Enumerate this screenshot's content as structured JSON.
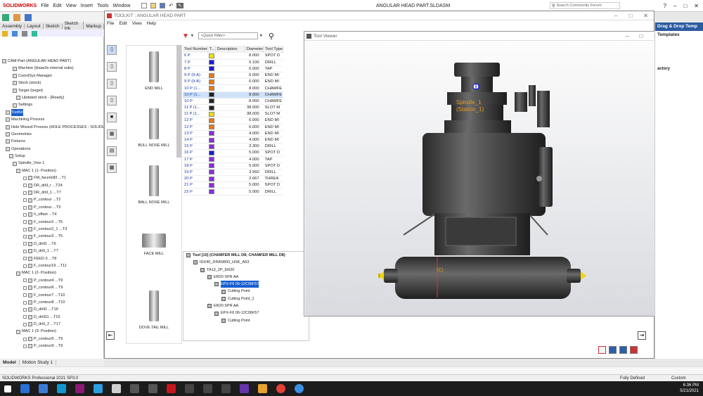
{
  "app": {
    "brand": "SOLIDWORKS",
    "menu": [
      "File",
      "Edit",
      "View",
      "Insert",
      "Tools",
      "Window"
    ],
    "doc_title": "ANGULAR HEAD PART.SLDASM",
    "search_placeholder": "Search Community Forum"
  },
  "cmd_tabs": [
    "Assembly",
    "Layout",
    "Sketch",
    "Sketch Ink",
    "Markup"
  ],
  "tree": [
    {
      "label": "CAM-Part (ANGULAR HEAD PART)",
      "indent": 0
    },
    {
      "label": "Machine (Haas3x internal subs)",
      "indent": 3
    },
    {
      "label": "CoordSys Manager",
      "indent": 3
    },
    {
      "label": "Stock (stock)",
      "indent": 3
    },
    {
      "label": "Target (target)",
      "indent": 3
    },
    {
      "label": "Updated stock - [Ready]",
      "indent": 4
    },
    {
      "label": "Settings",
      "indent": 3
    },
    {
      "label": "ToolKit",
      "indent": 1,
      "selected": true
    },
    {
      "label": "Machining Process",
      "indent": 1
    },
    {
      "label": "Hole Wizard Process (HOLE PROCESSES - SOLIDWO",
      "indent": 1
    },
    {
      "label": "Geometries",
      "indent": 1
    },
    {
      "label": "Fixtures",
      "indent": 1
    },
    {
      "label": "Operations",
      "indent": 1
    },
    {
      "label": "Setup",
      "indent": 2
    },
    {
      "label": "Spindle_Vise 1",
      "indent": 3
    },
    {
      "label": "MAC 1 (1- Position)",
      "indent": 4
    },
    {
      "label": "FM_facemill3 ...T1",
      "indent": 6
    },
    {
      "label": "DR_drill_r ...T24",
      "indent": 6
    },
    {
      "label": "DR_drill_1 ...T7",
      "indent": 6
    },
    {
      "label": "P_contour ...T2",
      "indent": 6
    },
    {
      "label": "P_contour ...T3",
      "indent": 6
    },
    {
      "label": "h_offset ...T4",
      "indent": 6
    },
    {
      "label": "F_contour2 ...T5",
      "indent": 6
    },
    {
      "label": "F_contour2_1 ...T3",
      "indent": 6
    },
    {
      "label": "F_contour3 ...T5",
      "indent": 6
    },
    {
      "label": "D_drill1 ...T6",
      "indent": 6
    },
    {
      "label": "D_drill_1 ...T7",
      "indent": 6
    },
    {
      "label": "FEED 0 ...T8",
      "indent": 6
    },
    {
      "label": "F_contour19 ...T11",
      "indent": 6
    },
    {
      "label": "MAC 1 (2- Position)",
      "indent": 4
    },
    {
      "label": "P_contour4 ...T9",
      "indent": 6
    },
    {
      "label": "P_contour6 ...T9",
      "indent": 6
    },
    {
      "label": "F_contour7 ...T10",
      "indent": 6
    },
    {
      "label": "P_contour8 ...T10",
      "indent": 6
    },
    {
      "label": "D_drill1 ...T16",
      "indent": 6
    },
    {
      "label": "D_drill11 ...T15",
      "indent": 6
    },
    {
      "label": "D_drill_2 ...T17",
      "indent": 6
    },
    {
      "label": "MAC 1 (3- Position)",
      "indent": 4
    },
    {
      "label": "P_contour5 ...T9",
      "indent": 6
    },
    {
      "label": "P_contour9 ...T9",
      "indent": 6
    }
  ],
  "toolkit": {
    "title": "TOOLKIT : ANGULAR HEAD PART",
    "menu": [
      "File",
      "Edit",
      "View",
      "Help"
    ],
    "filter_placeholder": "<Quick Filter>",
    "cards": [
      "END MILL",
      "BULL NOSE MILL",
      "BALL NOSE MILL",
      "FACE MILL",
      "DOVE TAIL MILL"
    ],
    "columns": [
      "Tool Number",
      "T...",
      "Description",
      "Diameter",
      "Tool Type"
    ],
    "rows": [
      {
        "num": "6 P",
        "color": "#f0e000",
        "dia": "8.000",
        "type": "SPOT D"
      },
      {
        "num": "7 P",
        "color": "#1a1ad8",
        "dia": "5.100",
        "type": "DRILL"
      },
      {
        "num": "8 P",
        "color": "#1a1ad8",
        "dia": "6.000",
        "type": "TAP"
      },
      {
        "num": "9 P (9-A)",
        "color": "#e87a10",
        "dia": "6.000",
        "type": "END MI"
      },
      {
        "num": "9 P (9-B)",
        "color": "#e87a10",
        "dia": "6.000",
        "type": "END MI"
      },
      {
        "num": "10 P (1...",
        "color": "#e87a10",
        "dia": "8.000",
        "type": "CHAMFE"
      },
      {
        "num": "10 P (1...",
        "color": "#222222",
        "dia": "8.000",
        "type": "CHAMFE",
        "selected": true
      },
      {
        "num": "10 P",
        "color": "#222222",
        "dia": "8.000",
        "type": "CHAMFE"
      },
      {
        "num": "11 P (1...",
        "color": "#222222",
        "dia": "38.000",
        "type": "SLOT M"
      },
      {
        "num": "11 P (1...",
        "color": "#f0e000",
        "dia": "38.000",
        "type": "SLOT M"
      },
      {
        "num": "12 P",
        "color": "#e87a10",
        "dia": "6.000",
        "type": "END MI"
      },
      {
        "num": "12 P",
        "color": "#e87a10",
        "dia": "6.000",
        "type": "END MI"
      },
      {
        "num": "13 P",
        "color": "#8a2be2",
        "dia": "4.000",
        "type": "END MI"
      },
      {
        "num": "14 P",
        "color": "#8a2be2",
        "dia": "4.000",
        "type": "END MI"
      },
      {
        "num": "15 P",
        "color": "#8a2be2",
        "dia": "3.300",
        "type": "DRILL"
      },
      {
        "num": "16 P",
        "color": "#1a1ad8",
        "dia": "5.000",
        "type": "SPOT D"
      },
      {
        "num": "17 P",
        "color": "#8a2be2",
        "dia": "4.000",
        "type": "TAP"
      },
      {
        "num": "18 P",
        "color": "#8a2be2",
        "dia": "5.000",
        "type": "SPOT D"
      },
      {
        "num": "19 P",
        "color": "#8a2be2",
        "dia": "3.560",
        "type": "DRILL"
      },
      {
        "num": "20 P",
        "color": "#8a2be2",
        "dia": "2.667",
        "type": "THREA"
      },
      {
        "num": "21 P",
        "color": "#8a2be2",
        "dia": "5.000",
        "type": "SPOT D"
      },
      {
        "num": "22 P",
        "color": "#8a2be2",
        "dia": "5.000",
        "type": "DRILL"
      }
    ],
    "assembly": [
      {
        "label": "Tool [10] (CHAMFER MILL D8; CHAMFER MILL D8)",
        "indent": 0,
        "bold": true
      },
      {
        "label": "IDX40_DIN69893_HSK_A63",
        "indent": 1
      },
      {
        "label": "TA13_2P_ER20",
        "indent": 2
      },
      {
        "label": "ER20 SPR AA",
        "indent": 3
      },
      {
        "label": "EPX-F6 06-12C06F57",
        "indent": 4,
        "selected": true
      },
      {
        "label": "Cutting Point",
        "indent": 5
      },
      {
        "label": "Cutting Point_1",
        "indent": 5
      },
      {
        "label": "ER20 SPR AA",
        "indent": 3
      },
      {
        "label": "EPX-F6 06-12C06F57",
        "indent": 4
      },
      {
        "label": "Cutting Point",
        "indent": 5
      }
    ]
  },
  "viewer": {
    "title": "Tool Viewer",
    "spindle_label": "Spindle_1 (Station_1)",
    "c_label": "(C)"
  },
  "right_panel": {
    "header": "Drag & Drop Temp",
    "sub": "Templates",
    "item": "actory"
  },
  "bottom_tabs": [
    "Model",
    "Motion Study 1"
  ],
  "status": {
    "product": "SOLIDWORKS Professional 2021 SP3.0",
    "state": "Fully Defined",
    "mode": "Custom"
  },
  "taskbar": {
    "time": "6:36 PM",
    "date": "5/21/2021"
  }
}
